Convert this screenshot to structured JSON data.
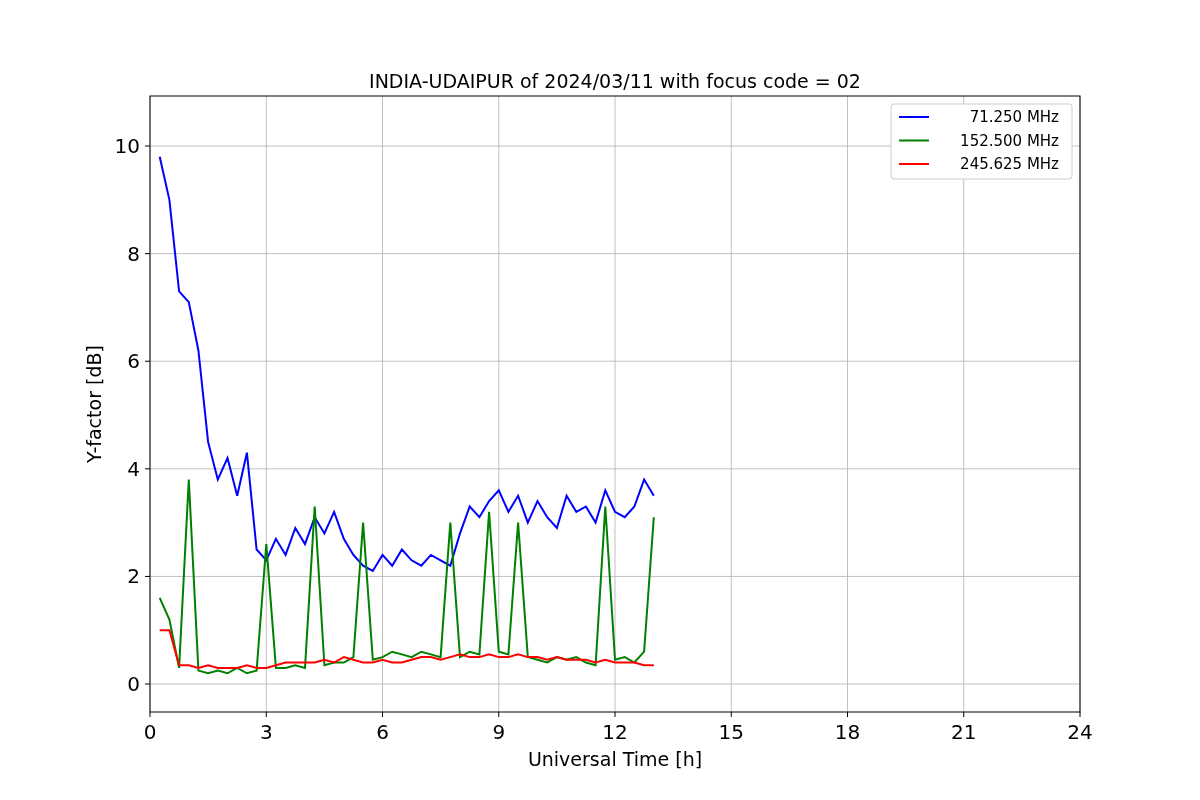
{
  "chart_data": {
    "type": "line",
    "title": "INDIA-UDAIPUR of 2024/03/11 with focus code = 02",
    "xlabel": "Universal Time [h]",
    "ylabel": "Y-factor [dB]",
    "grid": true,
    "legend": true,
    "xlim": [
      0,
      24
    ],
    "ylim": [
      -0.52,
      10.93
    ],
    "xticks": [
      0,
      3,
      6,
      9,
      12,
      15,
      18,
      21,
      24
    ],
    "yticks": [
      0,
      2,
      4,
      6,
      8,
      10
    ],
    "x": [
      0.25,
      0.5,
      0.75,
      1.0,
      1.25,
      1.5,
      1.75,
      2.0,
      2.25,
      2.5,
      2.75,
      3.0,
      3.25,
      3.5,
      3.75,
      4.0,
      4.25,
      4.5,
      4.75,
      5.0,
      5.25,
      5.5,
      5.75,
      6.0,
      6.25,
      6.5,
      6.75,
      7.0,
      7.25,
      7.5,
      7.75,
      8.0,
      8.25,
      8.5,
      8.75,
      9.0,
      9.25,
      9.5,
      9.75,
      10.0,
      10.25,
      10.5,
      10.75,
      11.0,
      11.25,
      11.5,
      11.75,
      12.0,
      12.25,
      12.5,
      12.75,
      13.0
    ],
    "series": [
      {
        "name": "71.250 MHz",
        "color": "#0000ff",
        "values": [
          9.8,
          9.0,
          7.3,
          7.1,
          6.2,
          4.5,
          3.8,
          4.2,
          3.5,
          4.3,
          2.5,
          2.3,
          2.7,
          2.4,
          2.9,
          2.6,
          3.1,
          2.8,
          3.2,
          2.7,
          2.4,
          2.2,
          2.1,
          2.4,
          2.2,
          2.5,
          2.3,
          2.2,
          2.4,
          2.3,
          2.2,
          2.8,
          3.3,
          3.1,
          3.4,
          3.6,
          3.2,
          3.5,
          3.0,
          3.4,
          3.1,
          2.9,
          3.5,
          3.2,
          3.3,
          3.0,
          3.6,
          3.2,
          3.1,
          3.3,
          3.8,
          3.5
        ]
      },
      {
        "name": "152.500 MHz",
        "color": "#008000",
        "values": [
          1.6,
          1.2,
          0.3,
          3.8,
          0.25,
          0.2,
          0.25,
          0.2,
          0.3,
          0.2,
          0.25,
          2.6,
          0.3,
          0.3,
          0.35,
          0.3,
          3.3,
          0.35,
          0.4,
          0.4,
          0.5,
          3.0,
          0.45,
          0.5,
          0.6,
          0.55,
          0.5,
          0.6,
          0.55,
          0.5,
          3.0,
          0.5,
          0.6,
          0.55,
          3.2,
          0.6,
          0.55,
          3.0,
          0.5,
          0.45,
          0.4,
          0.5,
          0.45,
          0.5,
          0.4,
          0.35,
          3.3,
          0.45,
          0.5,
          0.4,
          0.6,
          3.1
        ]
      },
      {
        "name": "245.625 MHz",
        "color": "#ff0000",
        "values": [
          1.0,
          1.0,
          0.35,
          0.35,
          0.3,
          0.35,
          0.3,
          0.3,
          0.3,
          0.35,
          0.3,
          0.3,
          0.35,
          0.4,
          0.4,
          0.4,
          0.4,
          0.45,
          0.4,
          0.5,
          0.45,
          0.4,
          0.4,
          0.45,
          0.4,
          0.4,
          0.45,
          0.5,
          0.5,
          0.45,
          0.5,
          0.55,
          0.5,
          0.5,
          0.55,
          0.5,
          0.5,
          0.55,
          0.5,
          0.5,
          0.45,
          0.5,
          0.45,
          0.45,
          0.45,
          0.4,
          0.45,
          0.4,
          0.4,
          0.4,
          0.35,
          0.35
        ]
      }
    ]
  }
}
